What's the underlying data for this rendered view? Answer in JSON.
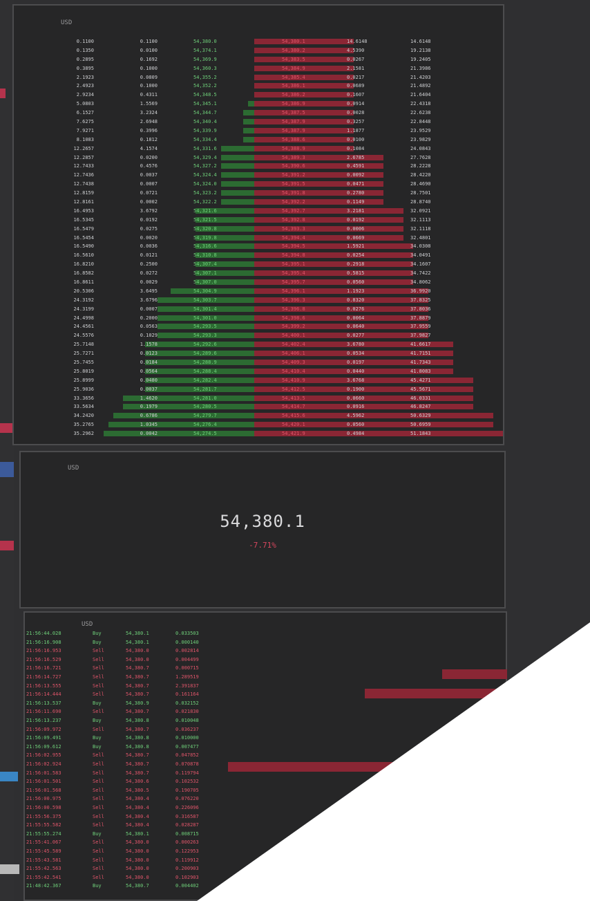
{
  "currency": "USD",
  "colors": {
    "bid": "#2c6b32",
    "ask": "#8a2634",
    "up": "#6fd07a",
    "down": "#e0556a"
  },
  "order_book": {
    "bids": [
      {
        "total": "0.1100",
        "size": "0.1100",
        "price": "54,380.0",
        "depth": 0.0
      },
      {
        "total": "0.1350",
        "size": "0.0100",
        "price": "54,374.1",
        "depth": 0.0
      },
      {
        "total": "0.2895",
        "size": "0.1692",
        "price": "54,369.9",
        "depth": 0.0
      },
      {
        "total": "0.3895",
        "size": "0.1000",
        "price": "54,360.3",
        "depth": 0.0
      },
      {
        "total": "2.1923",
        "size": "0.0809",
        "price": "54,355.2",
        "depth": 0.0
      },
      {
        "total": "2.4923",
        "size": "0.1000",
        "price": "54,352.2",
        "depth": 0.0
      },
      {
        "total": "2.9234",
        "size": "0.4311",
        "price": "54,348.5",
        "depth": 0.0
      },
      {
        "total": "5.0803",
        "size": "1.5569",
        "price": "54,345.1",
        "depth": 0.09
      },
      {
        "total": "6.1527",
        "size": "3.2324",
        "price": "54,344.7",
        "depth": 0.12
      },
      {
        "total": "7.6275",
        "size": "2.6948",
        "price": "54,340.4",
        "depth": 0.12
      },
      {
        "total": "7.9271",
        "size": "0.3996",
        "price": "54,339.9",
        "depth": 0.12
      },
      {
        "total": "8.1083",
        "size": "0.1812",
        "price": "54,334.4",
        "depth": 0.12
      },
      {
        "total": "12.2657",
        "size": "4.1574",
        "price": "54,331.6",
        "depth": 0.26
      },
      {
        "total": "12.2857",
        "size": "0.0200",
        "price": "54,329.4",
        "depth": 0.26
      },
      {
        "total": "12.7433",
        "size": "0.4576",
        "price": "54,327.2",
        "depth": 0.26
      },
      {
        "total": "12.7436",
        "size": "0.0037",
        "price": "54,324.4",
        "depth": 0.26
      },
      {
        "total": "12.7438",
        "size": "0.0007",
        "price": "54,324.0",
        "depth": 0.26
      },
      {
        "total": "12.8159",
        "size": "0.0721",
        "price": "54,323.2",
        "depth": 0.26
      },
      {
        "total": "12.8161",
        "size": "0.0002",
        "price": "54,322.2",
        "depth": 0.26
      },
      {
        "total": "16.4953",
        "size": "3.6792",
        "price": "54,321.6",
        "depth": 0.42
      },
      {
        "total": "16.5345",
        "size": "0.0192",
        "price": "54,321.5",
        "depth": 0.42
      },
      {
        "total": "16.5479",
        "size": "0.0275",
        "price": "54,320.8",
        "depth": 0.42
      },
      {
        "total": "16.5454",
        "size": "0.0020",
        "price": "54,319.8",
        "depth": 0.42
      },
      {
        "total": "16.5490",
        "size": "0.0036",
        "price": "54,316.6",
        "depth": 0.42
      },
      {
        "total": "16.5610",
        "size": "0.0121",
        "price": "54,310.8",
        "depth": 0.42
      },
      {
        "total": "16.8210",
        "size": "0.2500",
        "price": "54,307.4",
        "depth": 0.42
      },
      {
        "total": "16.8582",
        "size": "0.0272",
        "price": "54,307.1",
        "depth": 0.42
      },
      {
        "total": "16.8611",
        "size": "0.0029",
        "price": "54,307.0",
        "depth": 0.42
      },
      {
        "total": "20.5306",
        "size": "3.6495",
        "price": "54,304.9",
        "depth": 0.58
      },
      {
        "total": "24.3192",
        "size": "3.6796",
        "price": "54,303.7",
        "depth": 0.66
      },
      {
        "total": "24.3199",
        "size": "0.0007",
        "price": "54,301.4",
        "depth": 0.66
      },
      {
        "total": "24.4998",
        "size": "0.2000",
        "price": "54,301.0",
        "depth": 0.66
      },
      {
        "total": "24.4561",
        "size": "0.0563",
        "price": "54,293.5",
        "depth": 0.66
      },
      {
        "total": "24.5576",
        "size": "0.1029",
        "price": "54,293.3",
        "depth": 0.66
      },
      {
        "total": "25.7148",
        "size": "1.1578",
        "price": "54,292.6",
        "depth": 0.74
      },
      {
        "total": "25.7271",
        "size": "0.0123",
        "price": "54,289.6",
        "depth": 0.74
      },
      {
        "total": "25.7455",
        "size": "0.0184",
        "price": "54,288.9",
        "depth": 0.74
      },
      {
        "total": "25.8019",
        "size": "0.0564",
        "price": "54,288.4",
        "depth": 0.74
      },
      {
        "total": "25.8999",
        "size": "0.0480",
        "price": "54,282.4",
        "depth": 0.74
      },
      {
        "total": "25.9036",
        "size": "0.0037",
        "price": "54,281.7",
        "depth": 0.74
      },
      {
        "total": "33.3656",
        "size": "1.4620",
        "price": "54,281.0",
        "depth": 0.88
      },
      {
        "total": "33.5634",
        "size": "0.1979",
        "price": "54,280.5",
        "depth": 0.88
      },
      {
        "total": "34.2420",
        "size": "0.6786",
        "price": "54,279.7",
        "depth": 0.94
      },
      {
        "total": "35.2765",
        "size": "1.0345",
        "price": "54,276.4",
        "depth": 0.97
      },
      {
        "total": "35.2962",
        "size": "0.0042",
        "price": "54,274.5",
        "depth": 1.0
      }
    ],
    "asks": [
      {
        "price": "54,380.1",
        "size": "14.6148",
        "total": "14.6148",
        "depth": 0.4
      },
      {
        "price": "54,380.2",
        "size": "4.5390",
        "total": "19.2138",
        "depth": 0.4
      },
      {
        "price": "54,383.5",
        "size": "0.0267",
        "total": "19.2405",
        "depth": 0.4
      },
      {
        "price": "54,384.9",
        "size": "2.1581",
        "total": "21.3986",
        "depth": 0.4
      },
      {
        "price": "54,385.4",
        "size": "0.0217",
        "total": "21.4203",
        "depth": 0.4
      },
      {
        "price": "54,386.1",
        "size": "0.0689",
        "total": "21.4892",
        "depth": 0.4
      },
      {
        "price": "54,386.2",
        "size": "0.1607",
        "total": "21.6404",
        "depth": 0.4
      },
      {
        "price": "54,386.9",
        "size": "0.0914",
        "total": "22.4318",
        "depth": 0.4
      },
      {
        "price": "54,387.5",
        "size": "0.0028",
        "total": "22.6238",
        "depth": 0.4
      },
      {
        "price": "54,387.9",
        "size": "0.3257",
        "total": "22.8448",
        "depth": 0.4
      },
      {
        "price": "54,387.9",
        "size": "1.1877",
        "total": "23.9529",
        "depth": 0.4
      },
      {
        "price": "54,388.6",
        "size": "0.0100",
        "total": "23.9829",
        "depth": 0.4
      },
      {
        "price": "54,388.9",
        "size": "0.1084",
        "total": "24.0843",
        "depth": 0.4
      },
      {
        "price": "54,389.3",
        "size": "2.6785",
        "total": "27.7628",
        "depth": 0.52
      },
      {
        "price": "54,390.6",
        "size": "0.4591",
        "total": "28.2228",
        "depth": 0.52
      },
      {
        "price": "54,391.2",
        "size": "0.0092",
        "total": "28.4220",
        "depth": 0.52
      },
      {
        "price": "54,391.5",
        "size": "0.0471",
        "total": "28.4690",
        "depth": 0.52
      },
      {
        "price": "54,391.8",
        "size": "0.2780",
        "total": "28.7501",
        "depth": 0.52
      },
      {
        "price": "54,392.2",
        "size": "0.1149",
        "total": "28.8740",
        "depth": 0.52
      },
      {
        "price": "54,392.7",
        "size": "3.2181",
        "total": "32.0921",
        "depth": 0.6
      },
      {
        "price": "54,392.8",
        "size": "0.0192",
        "total": "32.1113",
        "depth": 0.6
      },
      {
        "price": "54,393.3",
        "size": "0.0006",
        "total": "32.1118",
        "depth": 0.6
      },
      {
        "price": "54,394.4",
        "size": "0.0669",
        "total": "32.4801",
        "depth": 0.6
      },
      {
        "price": "54,394.5",
        "size": "1.5921",
        "total": "34.0308",
        "depth": 0.64
      },
      {
        "price": "54,394.8",
        "size": "0.0254",
        "total": "34.0491",
        "depth": 0.64
      },
      {
        "price": "54,395.1",
        "size": "0.2918",
        "total": "34.1607",
        "depth": 0.64
      },
      {
        "price": "54,395.4",
        "size": "0.5815",
        "total": "34.7422",
        "depth": 0.64
      },
      {
        "price": "54,395.7",
        "size": "0.0560",
        "total": "34.8062",
        "depth": 0.64
      },
      {
        "price": "54,396.1",
        "size": "1.1923",
        "total": "36.9920",
        "depth": 0.7
      },
      {
        "price": "54,396.3",
        "size": "0.8320",
        "total": "37.8325",
        "depth": 0.7
      },
      {
        "price": "54,396.8",
        "size": "0.0276",
        "total": "37.8036",
        "depth": 0.7
      },
      {
        "price": "54,398.6",
        "size": "0.0064",
        "total": "37.8879",
        "depth": 0.7
      },
      {
        "price": "54,399.2",
        "size": "0.0640",
        "total": "37.9559",
        "depth": 0.7
      },
      {
        "price": "54,400.1",
        "size": "0.0277",
        "total": "37.9827",
        "depth": 0.7
      },
      {
        "price": "54,402.4",
        "size": "3.6780",
        "total": "41.6617",
        "depth": 0.8
      },
      {
        "price": "54,406.1",
        "size": "0.0534",
        "total": "41.7151",
        "depth": 0.8
      },
      {
        "price": "54,409.3",
        "size": "0.0197",
        "total": "41.7343",
        "depth": 0.8
      },
      {
        "price": "54,410.4",
        "size": "0.0440",
        "total": "41.8083",
        "depth": 0.8
      },
      {
        "price": "54,410.9",
        "size": "3.6768",
        "total": "45.4271",
        "depth": 0.88
      },
      {
        "price": "54,412.5",
        "size": "0.1900",
        "total": "45.5671",
        "depth": 0.88
      },
      {
        "price": "54,413.5",
        "size": "0.0660",
        "total": "46.0331",
        "depth": 0.88
      },
      {
        "price": "54,414.7",
        "size": "0.0916",
        "total": "46.8247",
        "depth": 0.88
      },
      {
        "price": "54,415.6",
        "size": "4.5962",
        "total": "50.6329",
        "depth": 0.96
      },
      {
        "price": "54,420.1",
        "size": "0.0560",
        "total": "50.6959",
        "depth": 0.96
      },
      {
        "price": "54,421.9",
        "size": "0.4984",
        "total": "51.1843",
        "depth": 1.0
      }
    ]
  },
  "ticker": {
    "price": "54,380.1",
    "change": "-7.71%"
  },
  "trades": [
    {
      "time": "21:56:44.028",
      "side": "Buy",
      "price": "54,380.1",
      "amount": "0.033503"
    },
    {
      "time": "21:56:16.908",
      "side": "Buy",
      "price": "54,380.1",
      "amount": "0.000140"
    },
    {
      "time": "21:56:16.953",
      "side": "Sell",
      "price": "54,380.0",
      "amount": "0.002814"
    },
    {
      "time": "21:56:16.529",
      "side": "Sell",
      "price": "54,380.0",
      "amount": "0.004499"
    },
    {
      "time": "21:56:16.721",
      "side": "Sell",
      "price": "54,380.7",
      "amount": "0.000715"
    },
    {
      "time": "21:56:14.727",
      "side": "Sell",
      "price": "54,380.7",
      "amount": "1.289519"
    },
    {
      "time": "21:56:13.555",
      "side": "Sell",
      "price": "54,380.7",
      "amount": "2.391837"
    },
    {
      "time": "21:56:14.444",
      "side": "Sell",
      "price": "54,380.7",
      "amount": "0.161164"
    },
    {
      "time": "21:56:13.537",
      "side": "Buy",
      "price": "54,380.9",
      "amount": "0.032152"
    },
    {
      "time": "21:56:11.690",
      "side": "Sell",
      "price": "54,380.7",
      "amount": "0.021830"
    },
    {
      "time": "21:56:13.237",
      "side": "Buy",
      "price": "54,380.8",
      "amount": "0.010048"
    },
    {
      "time": "21:56:09.972",
      "side": "Sell",
      "price": "54,380.7",
      "amount": "0.036237"
    },
    {
      "time": "21:56:09.491",
      "side": "Buy",
      "price": "54,380.8",
      "amount": "0.010000"
    },
    {
      "time": "21:56:09.612",
      "side": "Buy",
      "price": "54,380.8",
      "amount": "0.007477"
    },
    {
      "time": "21:56:02.955",
      "side": "Sell",
      "price": "54,380.7",
      "amount": "0.047852"
    },
    {
      "time": "21:56:02.924",
      "side": "Sell",
      "price": "54,380.7",
      "amount": "0.070878"
    },
    {
      "time": "21:56:01.583",
      "side": "Sell",
      "price": "54,380.7",
      "amount": "0.119794"
    },
    {
      "time": "21:56:01.501",
      "side": "Sell",
      "price": "54,380.6",
      "amount": "0.102532"
    },
    {
      "time": "21:56:01.568",
      "side": "Sell",
      "price": "54,380.5",
      "amount": "0.190705"
    },
    {
      "time": "21:56:00.975",
      "side": "Sell",
      "price": "54,380.4",
      "amount": "0.076220"
    },
    {
      "time": "21:56:00.598",
      "side": "Sell",
      "price": "54,380.4",
      "amount": "0.226096"
    },
    {
      "time": "21:55:56.375",
      "side": "Sell",
      "price": "54,380.4",
      "amount": "0.316587"
    },
    {
      "time": "21:55:55.582",
      "side": "Sell",
      "price": "54,380.4",
      "amount": "0.028287"
    },
    {
      "time": "21:55:55.274",
      "side": "Buy",
      "price": "54,380.1",
      "amount": "0.008715"
    },
    {
      "time": "21:55:41.067",
      "side": "Sell",
      "price": "54,380.0",
      "amount": "0.000263"
    },
    {
      "time": "21:55:45.589",
      "side": "Sell",
      "price": "54,380.0",
      "amount": "0.122953"
    },
    {
      "time": "21:55:43.581",
      "side": "Sell",
      "price": "54,380.0",
      "amount": "0.119912"
    },
    {
      "time": "21:55:42.563",
      "side": "Sell",
      "price": "54,380.0",
      "amount": "0.200903"
    },
    {
      "time": "21:55:42.541",
      "side": "Sell",
      "price": "54,380.0",
      "amount": "0.102903"
    },
    {
      "time": "21:48:42.367",
      "side": "Buy",
      "price": "54,380.7",
      "amount": "0.004402"
    }
  ],
  "sidebar_marks": [
    {
      "color": "#b5334c"
    },
    {
      "color": "#b5334c"
    },
    {
      "color": "#3c5a9a"
    },
    {
      "color": "#b5334c"
    },
    {
      "color": "#3a86c4"
    },
    {
      "color": "#b8b8b8"
    }
  ]
}
